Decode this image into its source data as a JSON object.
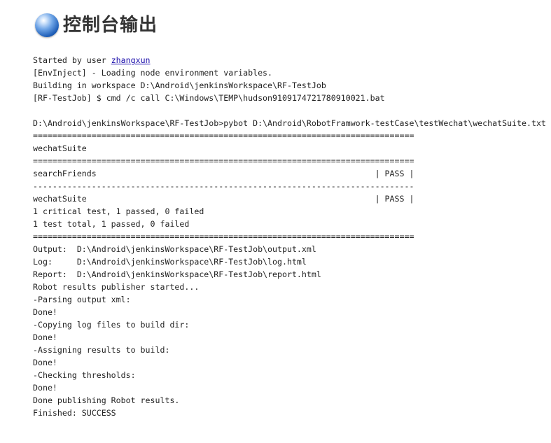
{
  "page": {
    "title": "控制台输出"
  },
  "console": {
    "started_prefix": "Started by user ",
    "user_link": "zhangxun",
    "lines": [
      "[EnvInject] - Loading node environment variables.",
      "Building in workspace D:\\Android\\jenkinsWorkspace\\RF-TestJob",
      "[RF-TestJob] $ cmd /c call C:\\Windows\\TEMP\\hudson9109174721780910021.bat",
      "",
      "D:\\Android\\jenkinsWorkspace\\RF-TestJob>pybot D:\\Android\\RobotFramwork-testCase\\testWechat\\wechatSuite.txt",
      "==============================================================================",
      "wechatSuite",
      "==============================================================================",
      "searchFriends                                                         | PASS |",
      "------------------------------------------------------------------------------",
      "wechatSuite                                                           | PASS |",
      "1 critical test, 1 passed, 0 failed",
      "1 test total, 1 passed, 0 failed",
      "==============================================================================",
      "Output:  D:\\Android\\jenkinsWorkspace\\RF-TestJob\\output.xml",
      "Log:     D:\\Android\\jenkinsWorkspace\\RF-TestJob\\log.html",
      "Report:  D:\\Android\\jenkinsWorkspace\\RF-TestJob\\report.html",
      "Robot results publisher started...",
      "-Parsing output xml:",
      "Done!",
      "-Copying log files to build dir:",
      "Done!",
      "-Assigning results to build:",
      "Done!",
      "-Checking thresholds:",
      "Done!",
      "Done publishing Robot results.",
      "Finished: SUCCESS"
    ]
  },
  "icons": {
    "header_icon": "blue-orb-icon"
  }
}
